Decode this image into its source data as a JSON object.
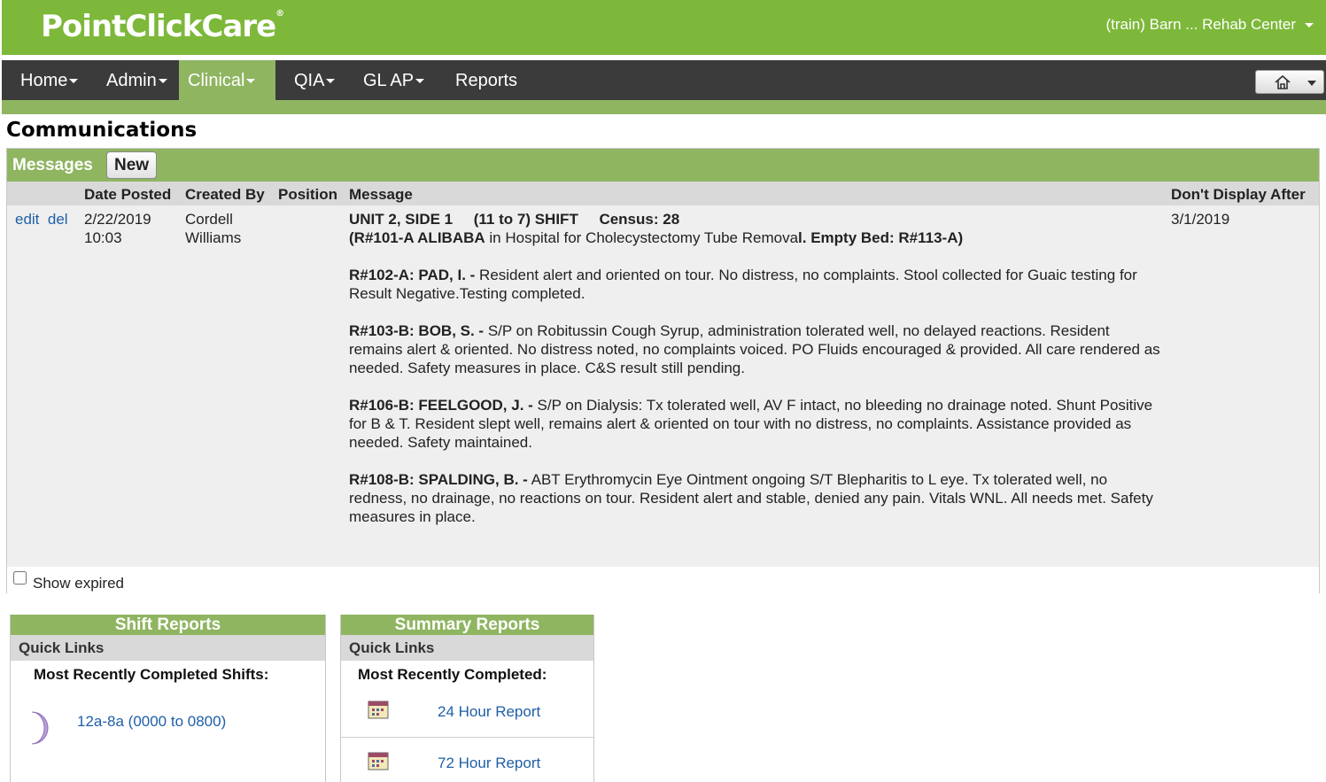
{
  "header": {
    "logo": "PointClickCare",
    "facility": "(train) Barn ... Rehab Center"
  },
  "nav": {
    "items": [
      {
        "label": "Home"
      },
      {
        "label": "Admin"
      },
      {
        "label": "Clinical"
      },
      {
        "label": "QIA"
      },
      {
        "label": "GL AP"
      },
      {
        "label": "Reports"
      }
    ],
    "active": "Clinical"
  },
  "page": {
    "title": "Communications"
  },
  "messages": {
    "title": "Messages",
    "new_label": "New",
    "columns": {
      "date_posted": "Date Posted",
      "created_by": "Created By",
      "position": "Position",
      "message": "Message",
      "dont_display_after": "Don't Display After"
    },
    "row": {
      "edit": "edit",
      "del": "del",
      "date": "2/22/2019",
      "time": "10:03",
      "created_by_first": "Cordell",
      "created_by_last": "Williams",
      "position": "",
      "dont_display_after": "3/1/2019",
      "line1": "UNIT 2, SIDE 1     (11 to 7) SHIFT     Census: 28",
      "line2_a": "(R#101-A ALIBABA",
      "line2_b": " in Hospital for Cholecystectomy Tube Remova",
      "line2_c": "l. Empty Bed: R#113-A)",
      "p1_bold": "R#102-A: PAD, I. -",
      "p1_text": " Resident alert and oriented on tour. No distress, no complaints. Stool collected for Guaic testing for Result Negative.Testing completed.",
      "p2_bold": "R#103-B: BOB, S. -",
      "p2_text": "  S/P on Robitussin Cough Syrup, administration tolerated well, no delayed reactions. Resident remains alert & oriented. No distress noted, no complaints voiced. PO Fluids encouraged & provided. All care rendered as needed. Safety measures in place. C&S result still pending.",
      "p3_bold": "R#106-B: FEELGOOD, J. -",
      "p3_text": " S/P on Dialysis: Tx tolerated well, AV F intact, no bleeding no drainage noted. Shunt Positive for B & T. Resident slept well, remains alert & oriented on tour with no distress, no complaints. Assistance provided as needed. Safety maintained.",
      "p4_bold": "R#108-B: SPALDING, B. -",
      "p4_text": "  ABT Erythromycin Eye Ointment ongoing S/T Blepharitis to L eye. Tx tolerated well, no redness, no drainage, no reactions on tour. Resident alert and stable, denied any pain. Vitals WNL. All needs met. Safety measures in place."
    },
    "show_expired": "Show expired"
  },
  "shift_reports": {
    "title": "Shift Reports",
    "quick_links": "Quick Links",
    "recent": "Most Recently Completed Shifts:",
    "link": "12a-8a (0000 to 0800)",
    "icon": "moon-icon"
  },
  "summary_reports": {
    "title": "Summary Reports",
    "quick_links": "Quick Links",
    "recent": "Most Recently Completed:",
    "links": [
      "24 Hour Report",
      "72 Hour Report"
    ],
    "icon": "calendar-icon"
  },
  "colors": {
    "brand_green": "#7db83a",
    "accent_green": "#8fb561",
    "nav_dark": "#3b3b3b",
    "link": "#1f5fa6"
  }
}
